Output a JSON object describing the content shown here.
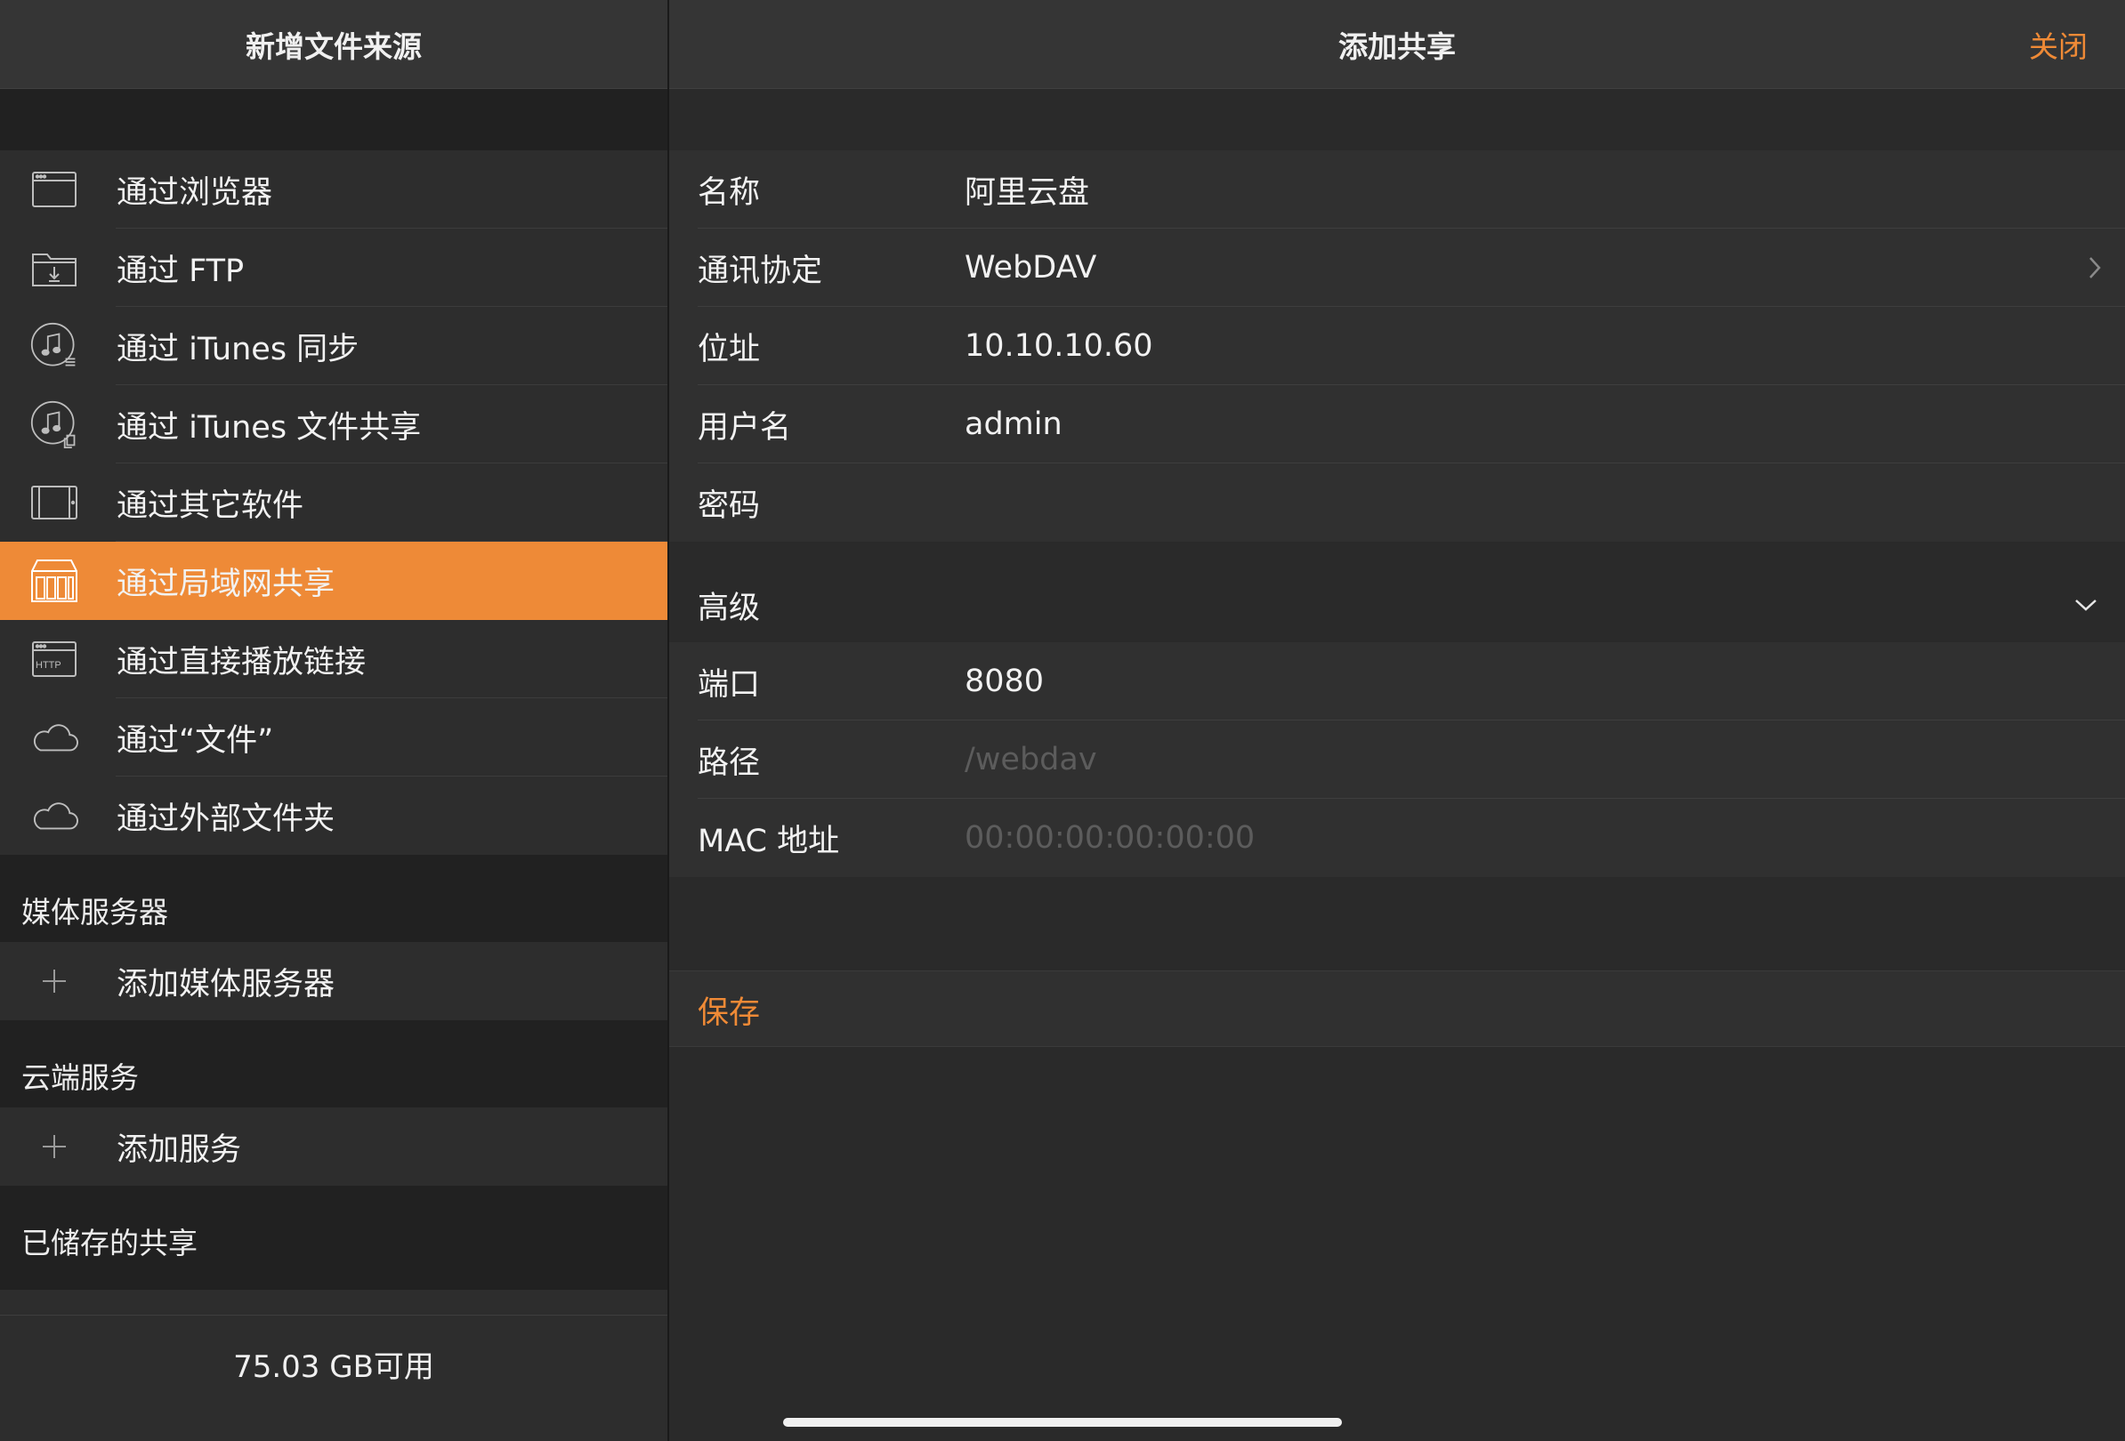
{
  "left": {
    "title": "新增文件来源",
    "sources": [
      {
        "label": "通过浏览器",
        "icon": "browser-window-icon"
      },
      {
        "label": "通过 FTP",
        "icon": "folder-download-icon"
      },
      {
        "label": "通过 iTunes 同步",
        "icon": "itunes-sync-icon"
      },
      {
        "label": "通过 iTunes 文件共享",
        "icon": "itunes-file-share-icon"
      },
      {
        "label": "通过其它软件",
        "icon": "tablet-icon"
      },
      {
        "label": "通过局域网共享",
        "icon": "nas-server-icon",
        "selected": true
      },
      {
        "label": "通过直接播放链接",
        "icon": "http-window-icon"
      },
      {
        "label": "通过“文件”",
        "icon": "cloud-icon"
      },
      {
        "label": "通过外部文件夹",
        "icon": "cloud-icon"
      }
    ],
    "media_section": {
      "title": "媒体服务器",
      "add_label": "添加媒体服务器"
    },
    "cloud_section": {
      "title": "云端服务",
      "add_label": "添加服务"
    },
    "saved_section": {
      "title": "已储存的共享"
    },
    "footer": "75.03 GB可用"
  },
  "right": {
    "title": "添加共享",
    "close_label": "关闭",
    "fields": {
      "name": {
        "label": "名称",
        "value": "阿里云盘"
      },
      "protocol": {
        "label": "通讯协定",
        "value": "WebDAV"
      },
      "address": {
        "label": "位址",
        "value": "10.10.10.60"
      },
      "username": {
        "label": "用户名",
        "value": "admin"
      },
      "password": {
        "label": "密码",
        "value": ""
      }
    },
    "advanced": {
      "label": "高级",
      "port": {
        "label": "端口",
        "value": "8080"
      },
      "path": {
        "label": "路径",
        "placeholder": "/webdav"
      },
      "mac": {
        "label": "MAC 地址",
        "placeholder": "00:00:00:00:00:00"
      }
    },
    "save_label": "保存"
  },
  "colors": {
    "accent": "#ef8a36",
    "selected_row": "#ee8a37",
    "background": "#2a2a2a",
    "header": "#353535"
  }
}
